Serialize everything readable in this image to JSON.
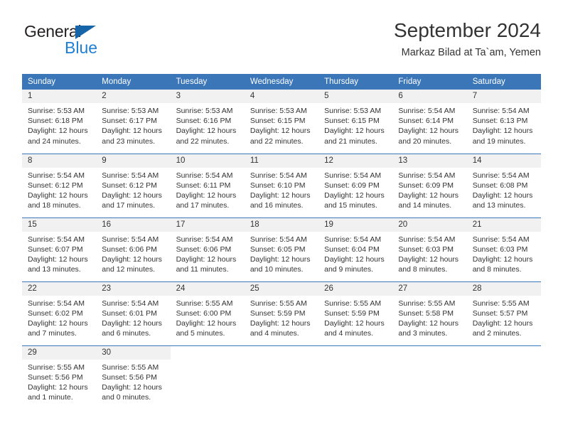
{
  "logo": {
    "word_top": "General",
    "word_bottom": "Blue",
    "triangle_color": "#1565a8",
    "blue_color": "#1f7fd4",
    "dark_color": "#231f20"
  },
  "header": {
    "title": "September 2024",
    "subtitle": "Markaz Bilad at Ta`am, Yemen"
  },
  "theme": {
    "header_blue": "#3a76b8",
    "day_band_gray": "#f1f1f1",
    "text_color": "#333333"
  },
  "weekdays": [
    "Sunday",
    "Monday",
    "Tuesday",
    "Wednesday",
    "Thursday",
    "Friday",
    "Saturday"
  ],
  "weeks": [
    [
      {
        "day": "1",
        "sunrise": "Sunrise: 5:53 AM",
        "sunset": "Sunset: 6:18 PM",
        "daylight1": "Daylight: 12 hours",
        "daylight2": "and 24 minutes."
      },
      {
        "day": "2",
        "sunrise": "Sunrise: 5:53 AM",
        "sunset": "Sunset: 6:17 PM",
        "daylight1": "Daylight: 12 hours",
        "daylight2": "and 23 minutes."
      },
      {
        "day": "3",
        "sunrise": "Sunrise: 5:53 AM",
        "sunset": "Sunset: 6:16 PM",
        "daylight1": "Daylight: 12 hours",
        "daylight2": "and 22 minutes."
      },
      {
        "day": "4",
        "sunrise": "Sunrise: 5:53 AM",
        "sunset": "Sunset: 6:15 PM",
        "daylight1": "Daylight: 12 hours",
        "daylight2": "and 22 minutes."
      },
      {
        "day": "5",
        "sunrise": "Sunrise: 5:53 AM",
        "sunset": "Sunset: 6:15 PM",
        "daylight1": "Daylight: 12 hours",
        "daylight2": "and 21 minutes."
      },
      {
        "day": "6",
        "sunrise": "Sunrise: 5:54 AM",
        "sunset": "Sunset: 6:14 PM",
        "daylight1": "Daylight: 12 hours",
        "daylight2": "and 20 minutes."
      },
      {
        "day": "7",
        "sunrise": "Sunrise: 5:54 AM",
        "sunset": "Sunset: 6:13 PM",
        "daylight1": "Daylight: 12 hours",
        "daylight2": "and 19 minutes."
      }
    ],
    [
      {
        "day": "8",
        "sunrise": "Sunrise: 5:54 AM",
        "sunset": "Sunset: 6:12 PM",
        "daylight1": "Daylight: 12 hours",
        "daylight2": "and 18 minutes."
      },
      {
        "day": "9",
        "sunrise": "Sunrise: 5:54 AM",
        "sunset": "Sunset: 6:12 PM",
        "daylight1": "Daylight: 12 hours",
        "daylight2": "and 17 minutes."
      },
      {
        "day": "10",
        "sunrise": "Sunrise: 5:54 AM",
        "sunset": "Sunset: 6:11 PM",
        "daylight1": "Daylight: 12 hours",
        "daylight2": "and 17 minutes."
      },
      {
        "day": "11",
        "sunrise": "Sunrise: 5:54 AM",
        "sunset": "Sunset: 6:10 PM",
        "daylight1": "Daylight: 12 hours",
        "daylight2": "and 16 minutes."
      },
      {
        "day": "12",
        "sunrise": "Sunrise: 5:54 AM",
        "sunset": "Sunset: 6:09 PM",
        "daylight1": "Daylight: 12 hours",
        "daylight2": "and 15 minutes."
      },
      {
        "day": "13",
        "sunrise": "Sunrise: 5:54 AM",
        "sunset": "Sunset: 6:09 PM",
        "daylight1": "Daylight: 12 hours",
        "daylight2": "and 14 minutes."
      },
      {
        "day": "14",
        "sunrise": "Sunrise: 5:54 AM",
        "sunset": "Sunset: 6:08 PM",
        "daylight1": "Daylight: 12 hours",
        "daylight2": "and 13 minutes."
      }
    ],
    [
      {
        "day": "15",
        "sunrise": "Sunrise: 5:54 AM",
        "sunset": "Sunset: 6:07 PM",
        "daylight1": "Daylight: 12 hours",
        "daylight2": "and 13 minutes."
      },
      {
        "day": "16",
        "sunrise": "Sunrise: 5:54 AM",
        "sunset": "Sunset: 6:06 PM",
        "daylight1": "Daylight: 12 hours",
        "daylight2": "and 12 minutes."
      },
      {
        "day": "17",
        "sunrise": "Sunrise: 5:54 AM",
        "sunset": "Sunset: 6:06 PM",
        "daylight1": "Daylight: 12 hours",
        "daylight2": "and 11 minutes."
      },
      {
        "day": "18",
        "sunrise": "Sunrise: 5:54 AM",
        "sunset": "Sunset: 6:05 PM",
        "daylight1": "Daylight: 12 hours",
        "daylight2": "and 10 minutes."
      },
      {
        "day": "19",
        "sunrise": "Sunrise: 5:54 AM",
        "sunset": "Sunset: 6:04 PM",
        "daylight1": "Daylight: 12 hours",
        "daylight2": "and 9 minutes."
      },
      {
        "day": "20",
        "sunrise": "Sunrise: 5:54 AM",
        "sunset": "Sunset: 6:03 PM",
        "daylight1": "Daylight: 12 hours",
        "daylight2": "and 8 minutes."
      },
      {
        "day": "21",
        "sunrise": "Sunrise: 5:54 AM",
        "sunset": "Sunset: 6:03 PM",
        "daylight1": "Daylight: 12 hours",
        "daylight2": "and 8 minutes."
      }
    ],
    [
      {
        "day": "22",
        "sunrise": "Sunrise: 5:54 AM",
        "sunset": "Sunset: 6:02 PM",
        "daylight1": "Daylight: 12 hours",
        "daylight2": "and 7 minutes."
      },
      {
        "day": "23",
        "sunrise": "Sunrise: 5:54 AM",
        "sunset": "Sunset: 6:01 PM",
        "daylight1": "Daylight: 12 hours",
        "daylight2": "and 6 minutes."
      },
      {
        "day": "24",
        "sunrise": "Sunrise: 5:55 AM",
        "sunset": "Sunset: 6:00 PM",
        "daylight1": "Daylight: 12 hours",
        "daylight2": "and 5 minutes."
      },
      {
        "day": "25",
        "sunrise": "Sunrise: 5:55 AM",
        "sunset": "Sunset: 5:59 PM",
        "daylight1": "Daylight: 12 hours",
        "daylight2": "and 4 minutes."
      },
      {
        "day": "26",
        "sunrise": "Sunrise: 5:55 AM",
        "sunset": "Sunset: 5:59 PM",
        "daylight1": "Daylight: 12 hours",
        "daylight2": "and 4 minutes."
      },
      {
        "day": "27",
        "sunrise": "Sunrise: 5:55 AM",
        "sunset": "Sunset: 5:58 PM",
        "daylight1": "Daylight: 12 hours",
        "daylight2": "and 3 minutes."
      },
      {
        "day": "28",
        "sunrise": "Sunrise: 5:55 AM",
        "sunset": "Sunset: 5:57 PM",
        "daylight1": "Daylight: 12 hours",
        "daylight2": "and 2 minutes."
      }
    ],
    [
      {
        "day": "29",
        "sunrise": "Sunrise: 5:55 AM",
        "sunset": "Sunset: 5:56 PM",
        "daylight1": "Daylight: 12 hours",
        "daylight2": "and 1 minute."
      },
      {
        "day": "30",
        "sunrise": "Sunrise: 5:55 AM",
        "sunset": "Sunset: 5:56 PM",
        "daylight1": "Daylight: 12 hours",
        "daylight2": "and 0 minutes."
      },
      null,
      null,
      null,
      null,
      null
    ]
  ]
}
